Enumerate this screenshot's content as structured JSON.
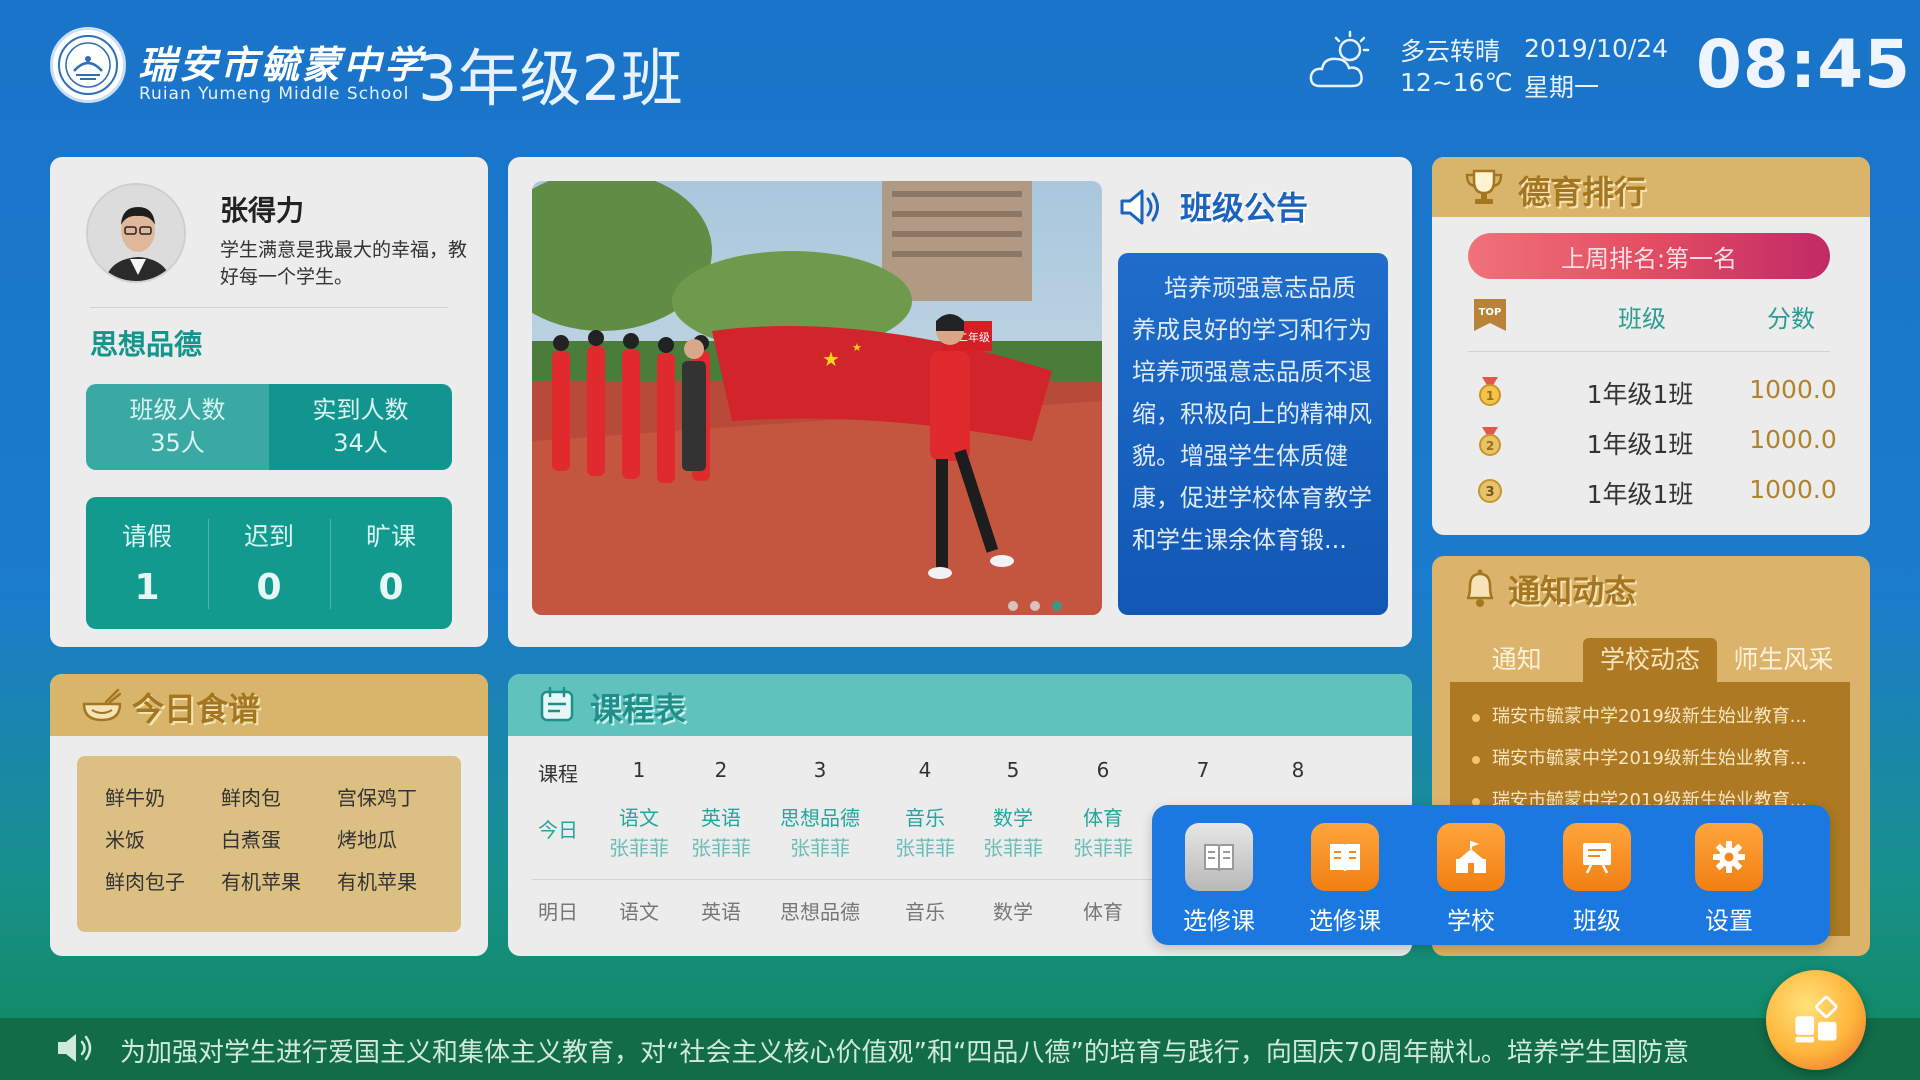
{
  "header": {
    "school_cn": "瑞安市毓蒙中学",
    "school_en": "Ruian Yumeng Middle School",
    "class_title": "3年级2班",
    "weather_desc": "多云转晴",
    "weather_temp": "12~16℃",
    "date": "2019/10/24",
    "weekday": "星期一",
    "time": "08:45",
    "weather_icon": "cloud-sun-icon"
  },
  "teacher": {
    "name": "张得力",
    "motto": "学生满意是我最大的幸福，教好每一个学生。",
    "section_title": "思想品德",
    "class_count_label": "班级人数",
    "class_count_value": "35人",
    "present_label": "实到人数",
    "present_value": "34人",
    "leave_label": "请假",
    "leave_value": "1",
    "late_label": "迟到",
    "late_value": "0",
    "absent_label": "旷课",
    "absent_value": "0"
  },
  "notice": {
    "title": "班级公告",
    "text": "培养顽强意志品质养成良好的学习和行为培养顽强意志品质不退缩，积极向上的精神风貌。增强学生体质健康，促进学校体育教学和学生课余体育锻...",
    "carousel_total": 3,
    "carousel_active": 3,
    "photo_banner": "高二年级"
  },
  "ranking": {
    "title": "德育排行",
    "last_week": "上周排名:第一名",
    "badge_text": "TOP",
    "col_class": "班级",
    "col_score": "分数",
    "rows": [
      {
        "medal": "1",
        "class": "1年级1班",
        "score": "1000.0"
      },
      {
        "medal": "2",
        "class": "1年级1班",
        "score": "1000.0"
      },
      {
        "medal": "3",
        "class": "1年级1班",
        "score": "1000.0"
      }
    ]
  },
  "news": {
    "title": "通知动态",
    "tabs": [
      "通知",
      "学校动态",
      "师生风采"
    ],
    "active_tab": 1,
    "items": [
      "瑞安市毓蒙中学2019级新生始业教育...",
      "瑞安市毓蒙中学2019级新生始业教育...",
      "瑞安市毓蒙中学2019级新生始业教育..."
    ]
  },
  "menu": {
    "title": "今日食谱",
    "items": [
      "鲜牛奶",
      "鲜肉包",
      "宫保鸡丁",
      "米饭",
      "白煮蛋",
      "烤地瓜",
      "鲜肉包子",
      "有机苹果",
      "有机苹果"
    ]
  },
  "schedule": {
    "title": "课程表",
    "header_label": "课程",
    "periods": [
      "1",
      "2",
      "3",
      "4",
      "5",
      "6",
      "7",
      "8"
    ],
    "today_label": "今日",
    "today_subjects": [
      "语文",
      "英语",
      "思想品德",
      "音乐",
      "数学",
      "体育"
    ],
    "today_teachers": [
      "张菲菲",
      "张菲菲",
      "张菲菲",
      "张菲菲",
      "张菲菲",
      "张菲菲"
    ],
    "tomorrow_label": "明日",
    "tomorrow_subjects": [
      "语文",
      "英语",
      "思想品德",
      "音乐",
      "数学",
      "体育"
    ]
  },
  "dock": {
    "items": [
      {
        "label": "选修课",
        "icon": "book-icon",
        "style": "grey"
      },
      {
        "label": "选修课",
        "icon": "book-icon",
        "style": "orange"
      },
      {
        "label": "学校",
        "icon": "school-icon",
        "style": "orange"
      },
      {
        "label": "班级",
        "icon": "presentation-board-icon",
        "style": "orange"
      },
      {
        "label": "设置",
        "icon": "gear-icon",
        "style": "orange"
      }
    ]
  },
  "ticker": {
    "text": "为加强对学生进行爱国主义和集体主义教育，对“社会主义核心价值观”和“四品八德”的培育与践行，向国庆70周年献礼。培养学生国防意"
  },
  "colors": {
    "teal": "#12958f",
    "gold": "#d8b56b",
    "dock_blue": "#1a78e0",
    "notice_blue": "#1257b4"
  }
}
